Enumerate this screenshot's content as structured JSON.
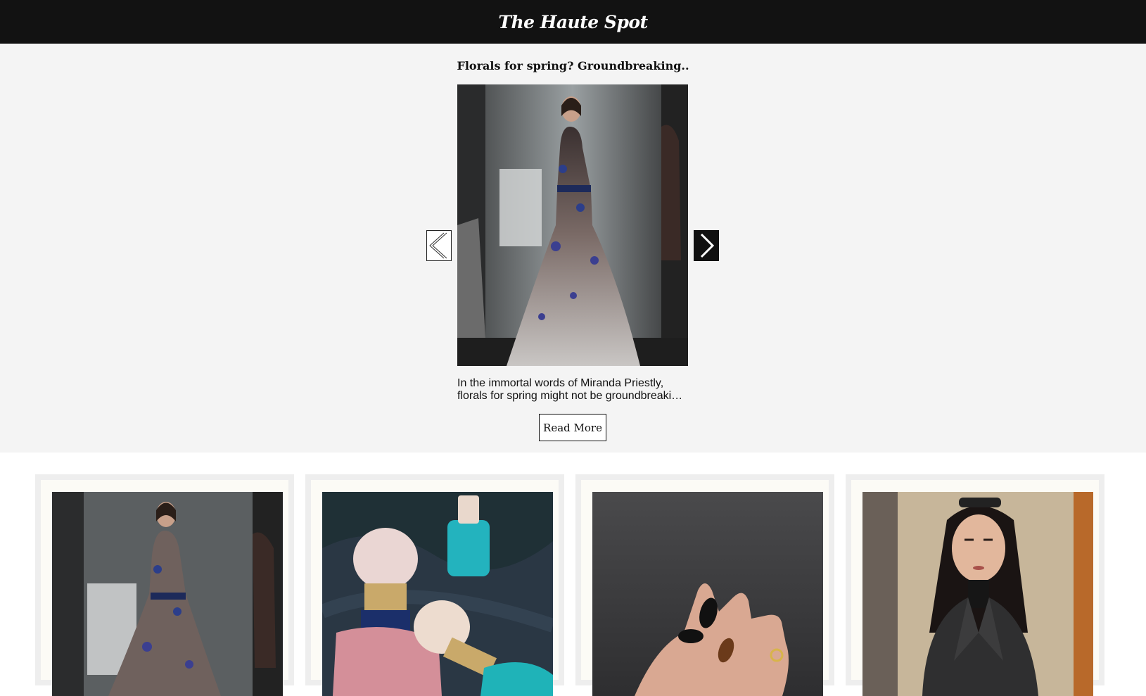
{
  "header": {
    "site_title": "The Haute Spot"
  },
  "featured": {
    "title": "Florals for spring? Groundbreaking..",
    "excerpt_line1": "In the immortal words of Miranda Priestly,",
    "excerpt_line2": "florals for spring might not be groundbreaking…",
    "read_more_label": "Read More",
    "image": "runway-floral-gown-photo"
  },
  "carousel": {
    "prev_icon": "chevron-left-icon",
    "next_icon": "chevron-right-icon"
  },
  "cards": [
    {
      "image": "runway-floral-gown-photo"
    },
    {
      "image": "perfume-bottles-photo"
    },
    {
      "image": "dark-manicure-photo"
    },
    {
      "image": "street-style-leather-jacket-photo"
    }
  ]
}
